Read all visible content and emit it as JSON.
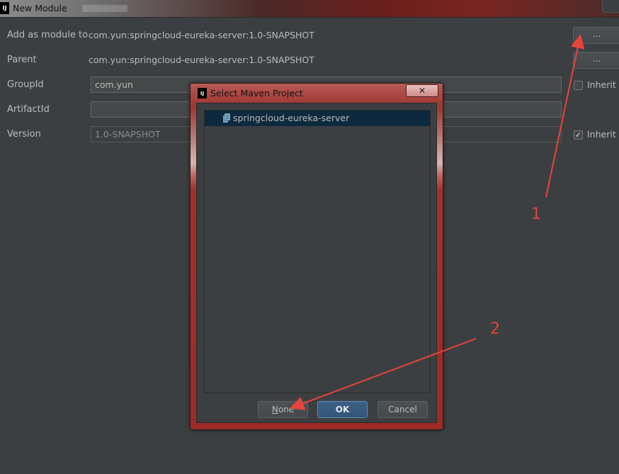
{
  "window": {
    "title": "New Module",
    "logo_text": "IJ"
  },
  "form": {
    "add_as_module_label": "Add as module to",
    "add_as_module_value": "com.yun:springcloud-eureka-server:1.0-SNAPSHOT",
    "parent_label": "Parent",
    "parent_value": "com.yun:springcloud-eureka-server:1.0-SNAPSHOT",
    "group_id_label": "GroupId",
    "group_id_value": "com.yun",
    "artifact_id_label": "ArtifactId",
    "artifact_id_value": "",
    "version_label": "Version",
    "version_value": "1.0-SNAPSHOT",
    "browse_label": "...",
    "inherit_label": "Inherit",
    "group_inherit_checked": false,
    "version_inherit_checked": true,
    "check_mark": "✓"
  },
  "dialog": {
    "title": "Select Maven Project",
    "close_glyph": "✕",
    "tree_items": [
      {
        "label": "springcloud-eureka-server"
      }
    ],
    "none_button_label": "None",
    "none_mnemonic": "N",
    "none_rest": "one",
    "ok_button_label": "OK",
    "cancel_button_label": "Cancel"
  },
  "annotations": {
    "first": "1",
    "second": "2",
    "color": "#e8433c"
  },
  "colors": {
    "background": "#3c3f41",
    "selection": "#0d293e",
    "primary_button": "#365880",
    "dialog_frame": "#a13b37"
  }
}
